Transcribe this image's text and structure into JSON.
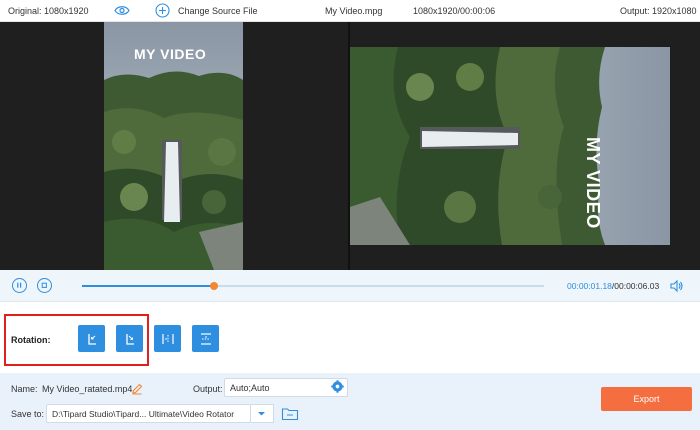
{
  "topbar": {
    "original": "Original: 1080x1920",
    "change_source": "Change Source File",
    "filename": "My Video.mpg",
    "resolution_duration": "1080x1920/00:00:06",
    "output": "Output: 1920x1080"
  },
  "preview": {
    "watermark": "MY VIDEO"
  },
  "playback": {
    "current_time": "00:00:01.18",
    "total_time": "/00:00:06.03",
    "progress_fraction": 0.285
  },
  "rotation": {
    "label": "Rotation:"
  },
  "settings": {
    "name_label": "Name:",
    "name_value": "My Video_ratated.mp4",
    "output_label": "Output:",
    "output_value": "Auto;Auto",
    "save_label": "Save to:",
    "save_path": "D:\\Tipard Studio\\Tipard... Ultimate\\Video Rotator",
    "export_label": "Export"
  },
  "colors": {
    "accent_blue": "#2e8ee0",
    "export_orange": "#f46e3f",
    "knob_orange": "#f2872f",
    "highlight_red": "#e0201c",
    "panel_bg": "#e9f2fb"
  }
}
